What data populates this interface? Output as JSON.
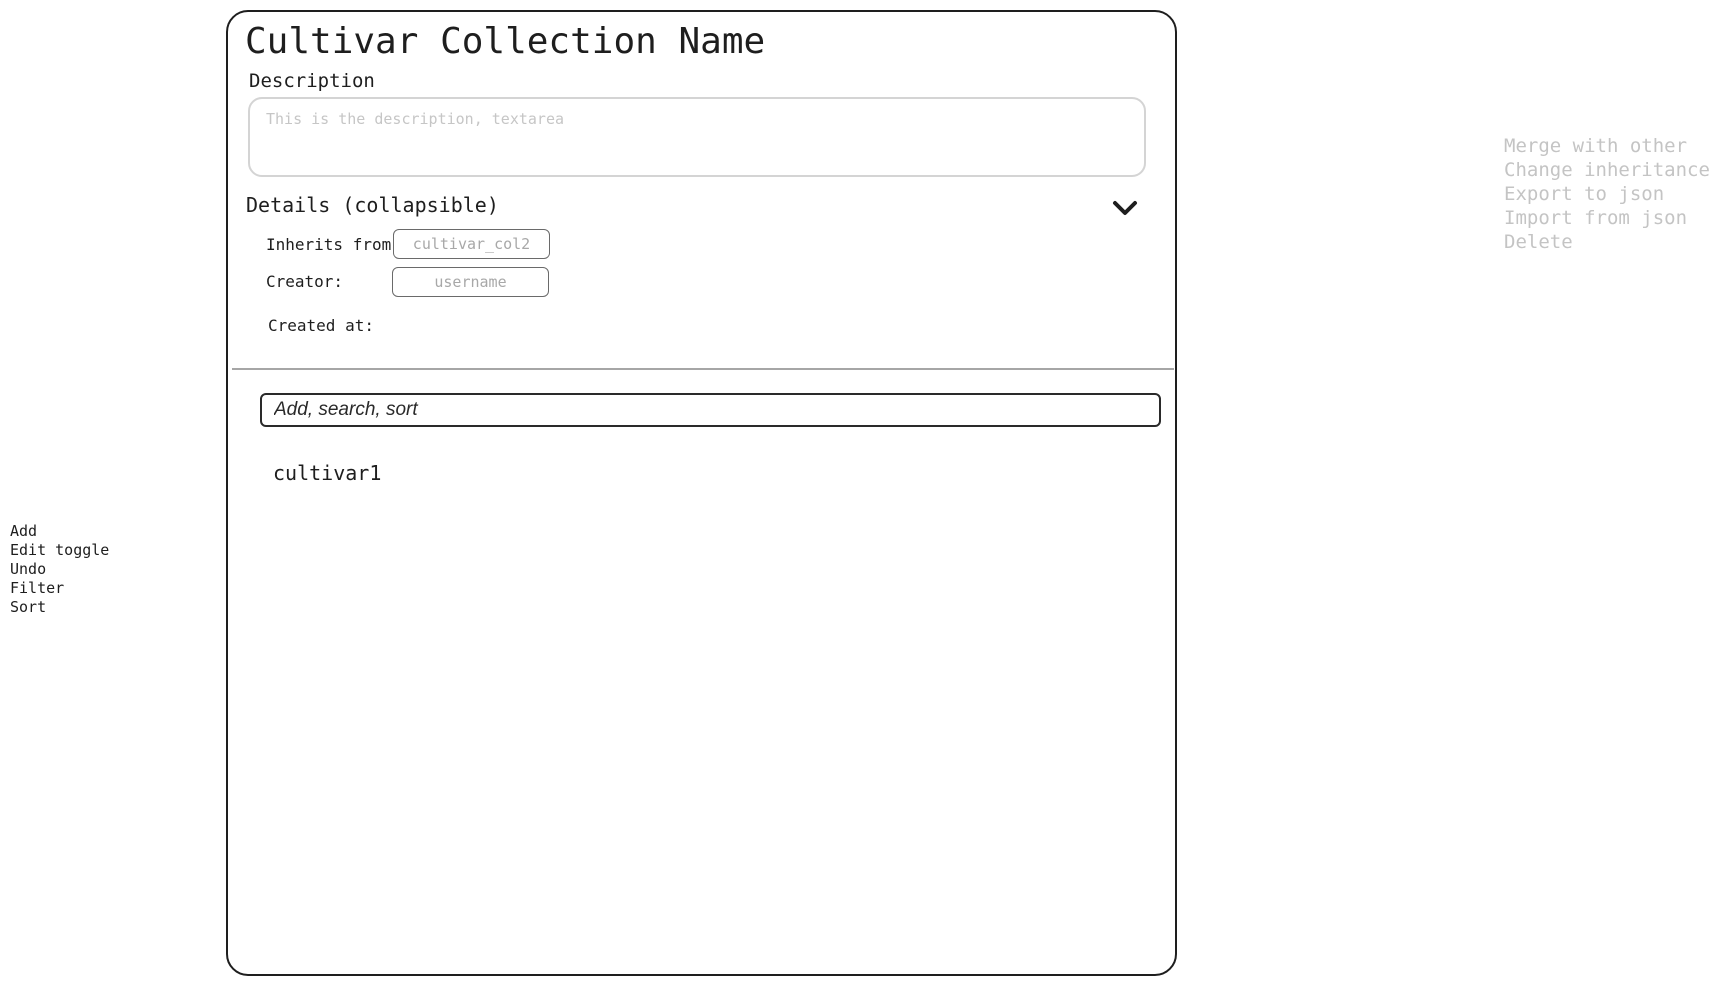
{
  "left_actions": [
    "Add",
    "Edit toggle",
    "Undo",
    "Filter",
    "Sort"
  ],
  "right_menu": [
    "Merge with other",
    "Change inheritance",
    "Export to json",
    "Import from json",
    "Delete"
  ],
  "collection": {
    "title": "Cultivar Collection Name",
    "description_label": "Description",
    "description_placeholder": "This is the description, textarea",
    "details_label": "Details (collapsible)",
    "details_icon": "chevron-down-icon",
    "inherits_label": "Inherits from:",
    "inherits_placeholder": "cultivar_col2",
    "creator_label": "Creator:",
    "creator_placeholder": "username",
    "created_at_label": "Created at:"
  },
  "search": {
    "placeholder": "Add, search, sort"
  },
  "cultivars": [
    "cultivar1"
  ],
  "colors": {
    "stroke": "#1e1e1e",
    "muted_text": "#c4c4c4",
    "divider": "#a6a6a6"
  }
}
